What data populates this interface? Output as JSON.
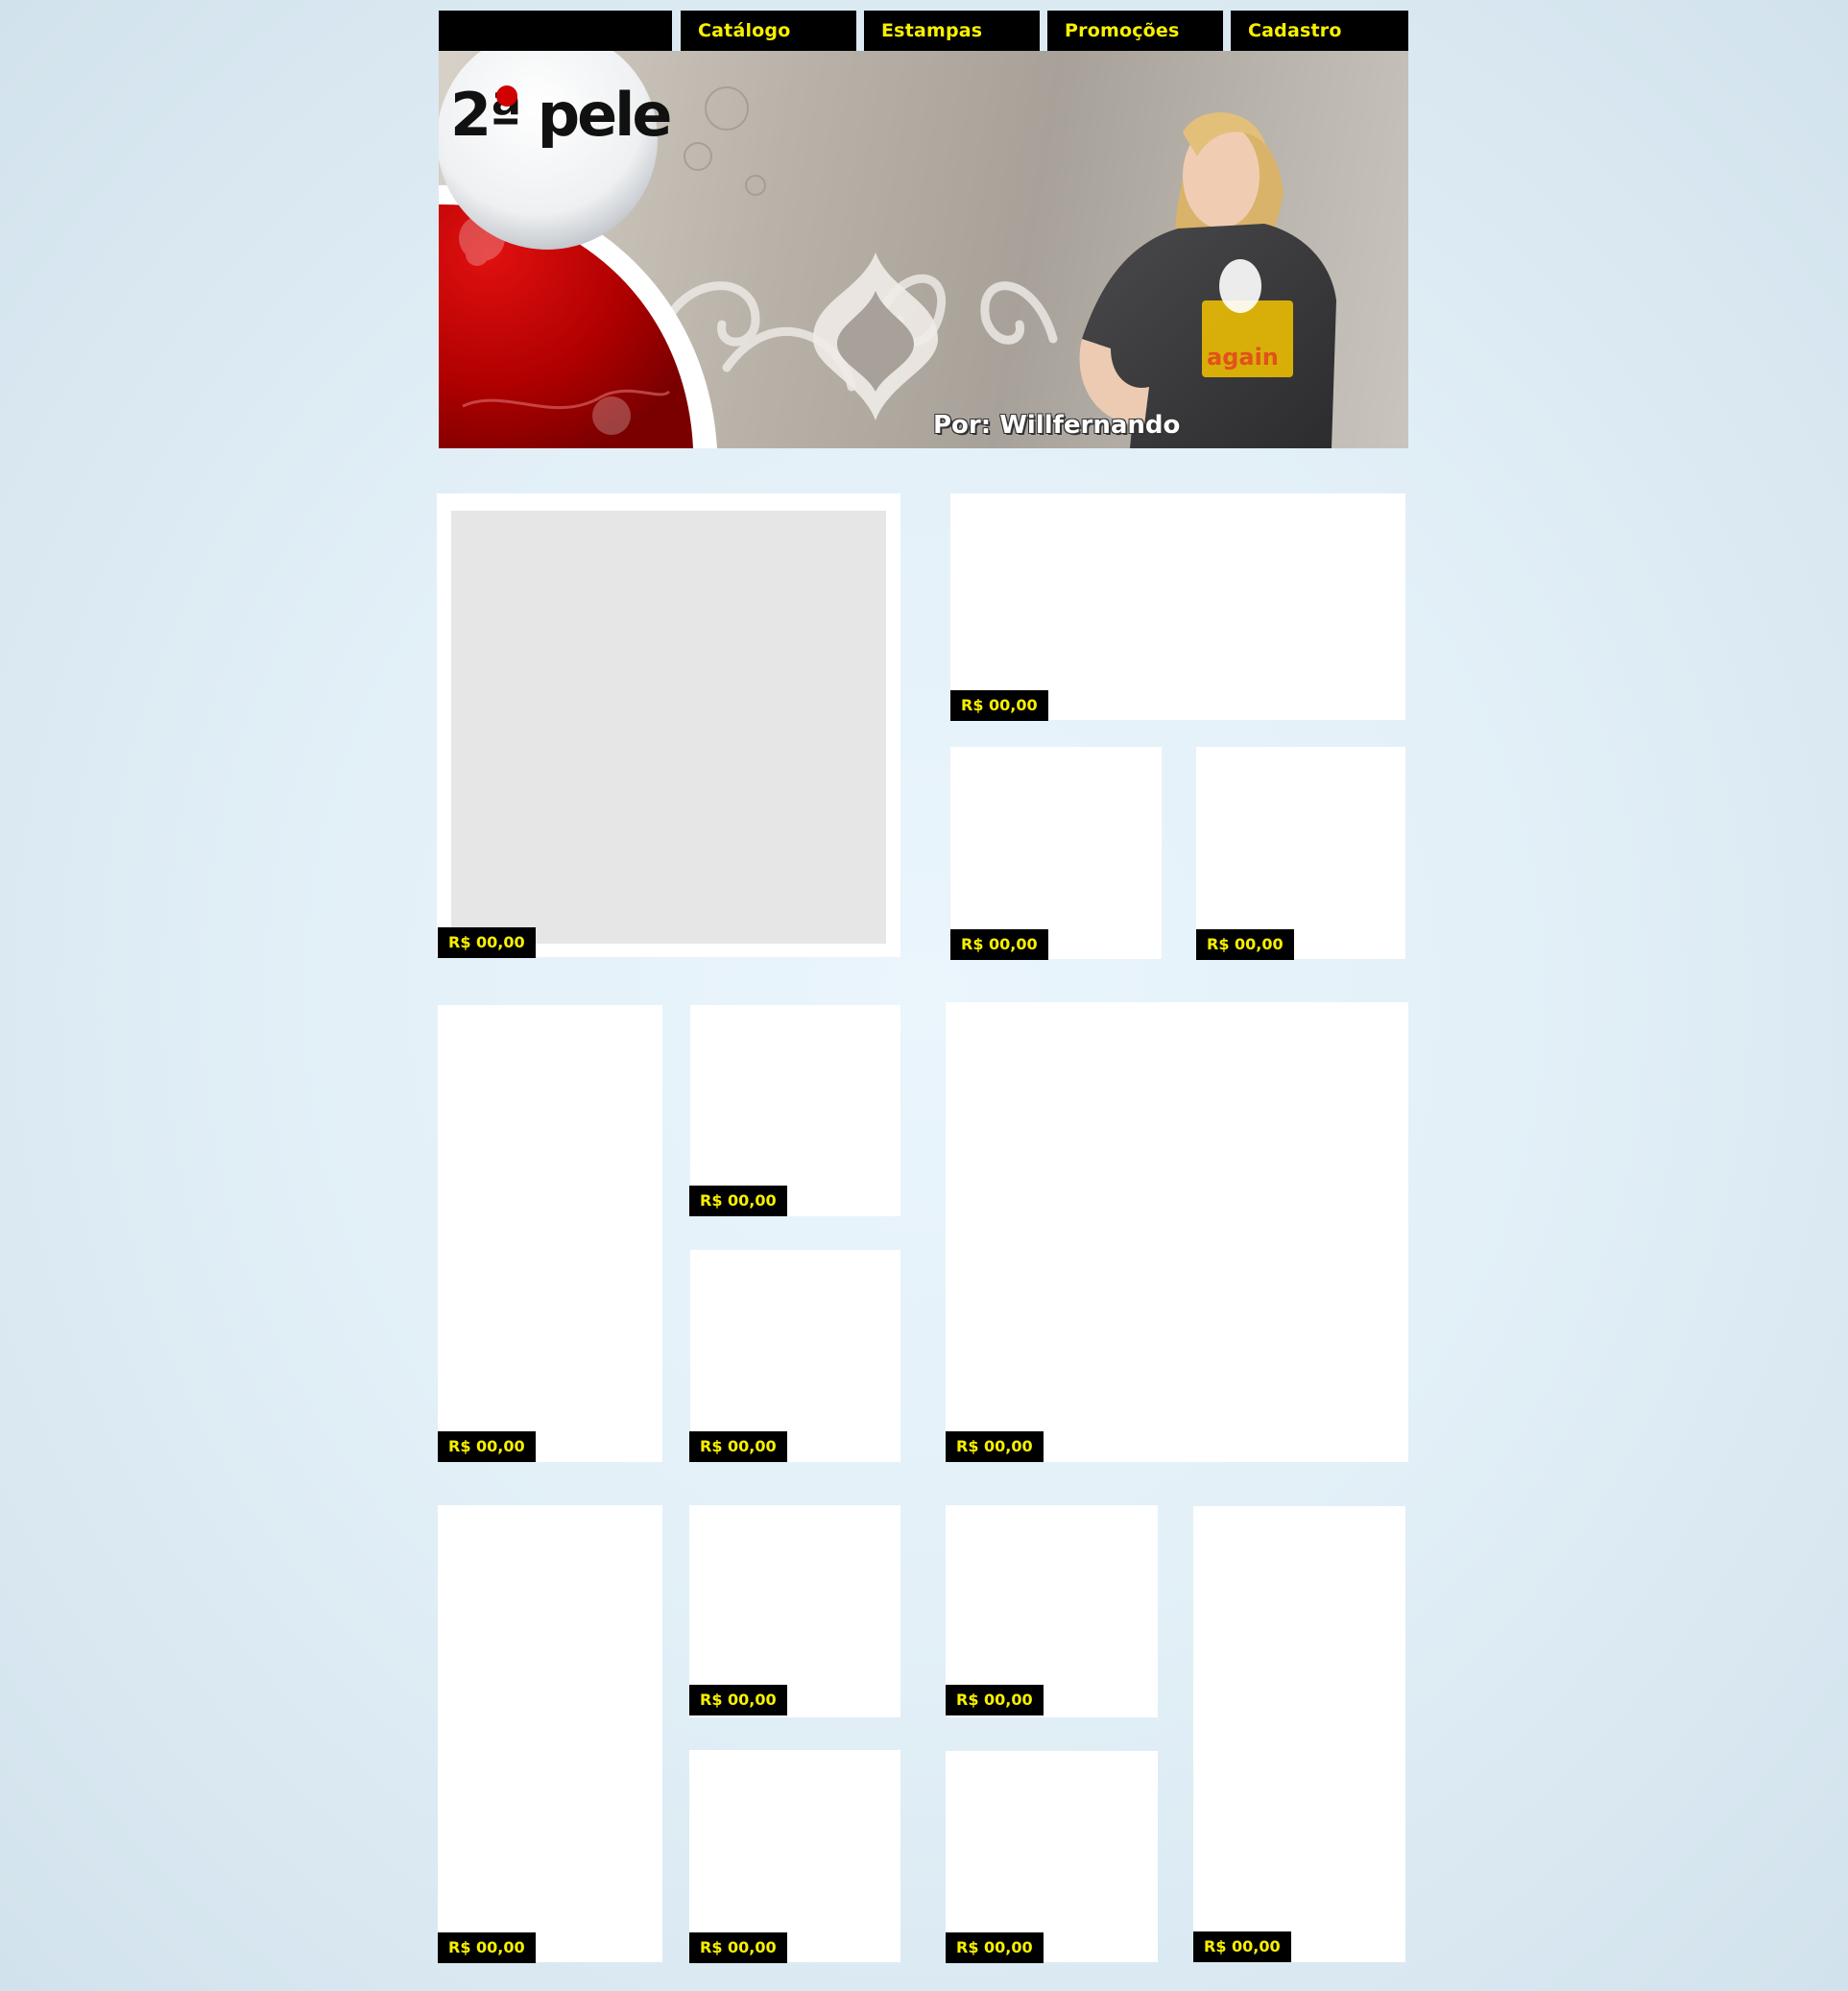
{
  "nav": {
    "items": [
      {
        "label": ""
      },
      {
        "label": "Catálogo"
      },
      {
        "label": "Estampas"
      },
      {
        "label": "Promoções"
      },
      {
        "label": "Cadastro"
      }
    ]
  },
  "banner": {
    "logo_text": "2ª pele",
    "byline": "Por: Willfernando",
    "shirt_text": "again"
  },
  "products": {
    "price_label": "R$ 00,00",
    "items": [
      {
        "price": "R$ 00,00"
      },
      {
        "price": "R$ 00,00"
      },
      {
        "price": "R$ 00,00"
      },
      {
        "price": "R$ 00,00"
      },
      {
        "price": "R$ 00,00"
      },
      {
        "price": "R$ 00,00"
      },
      {
        "price": "R$ 00,00"
      },
      {
        "price": "R$ 00,00"
      },
      {
        "price": "R$ 00,00"
      },
      {
        "price": "R$ 00,00"
      },
      {
        "price": "R$ 00,00"
      },
      {
        "price": "R$ 00,00"
      },
      {
        "price": "R$ 00,00"
      },
      {
        "price": "R$ 00,00"
      },
      {
        "price": "R$ 00,00"
      }
    ]
  },
  "colors": {
    "nav_bg": "#000000",
    "nav_text": "#f7f000",
    "price_bg": "#000000",
    "price_text": "#f7f000",
    "brand_red": "#c40000"
  }
}
